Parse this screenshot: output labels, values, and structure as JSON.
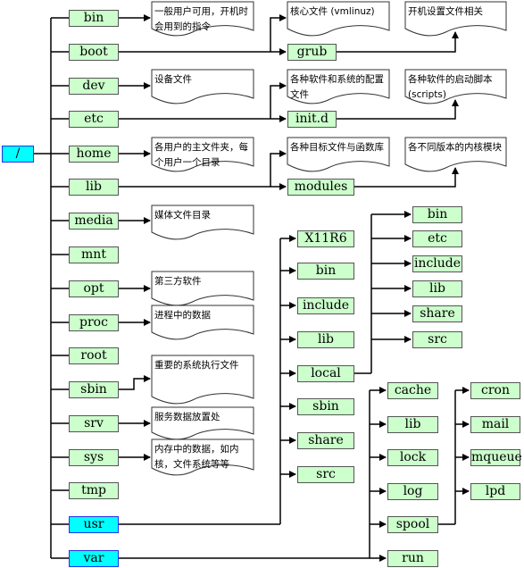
{
  "root": "/",
  "top_dirs": [
    "bin",
    "boot",
    "dev",
    "etc",
    "home",
    "lib",
    "media",
    "mnt",
    "opt",
    "proc",
    "root",
    "sbin",
    "srv",
    "sys",
    "tmp",
    "usr",
    "var"
  ],
  "highlighted_dirs": [
    "/",
    "usr",
    "var"
  ],
  "notes": {
    "bin": "一般用户可用，开机时会用到的指令",
    "dev": "设备文件",
    "home": "各用户的主文件夹，每个用户一个目录",
    "media": "媒体文件目录",
    "opt": "第三方软件",
    "proc": "进程中的数据",
    "sbin": "重要的系统执行文件",
    "srv": "服务数据放置处",
    "sys": "内存中的数据，如内核，文件系统等等",
    "boot_kernel": "核心文件 (vmlinuz)",
    "grub": "开机设置文件相关",
    "etc_config": "各种软件和系统的配置文件",
    "init_d": "各种软件的启动脚本(scripts)",
    "lib_libs": "各种目标文件与函数库",
    "modules": "各不同版本的内核模块"
  },
  "sub_dirs": {
    "boot": "grub",
    "etc": "init.d",
    "lib": "modules"
  },
  "usr_children": [
    "X11R6",
    "bin",
    "include",
    "lib",
    "local",
    "sbin",
    "share",
    "src"
  ],
  "local_children": [
    "bin",
    "etc",
    "include",
    "lib",
    "share",
    "src"
  ],
  "var_children": [
    "cache",
    "lib",
    "lock",
    "log",
    "spool",
    "run"
  ],
  "spool_children": [
    "cron",
    "mail",
    "mqueue",
    "lpd"
  ],
  "colors": {
    "dir_fill": "#ccffcc",
    "highlight_fill": "#00ffff",
    "highlight_border": "#2233ee",
    "line": "#000000"
  }
}
